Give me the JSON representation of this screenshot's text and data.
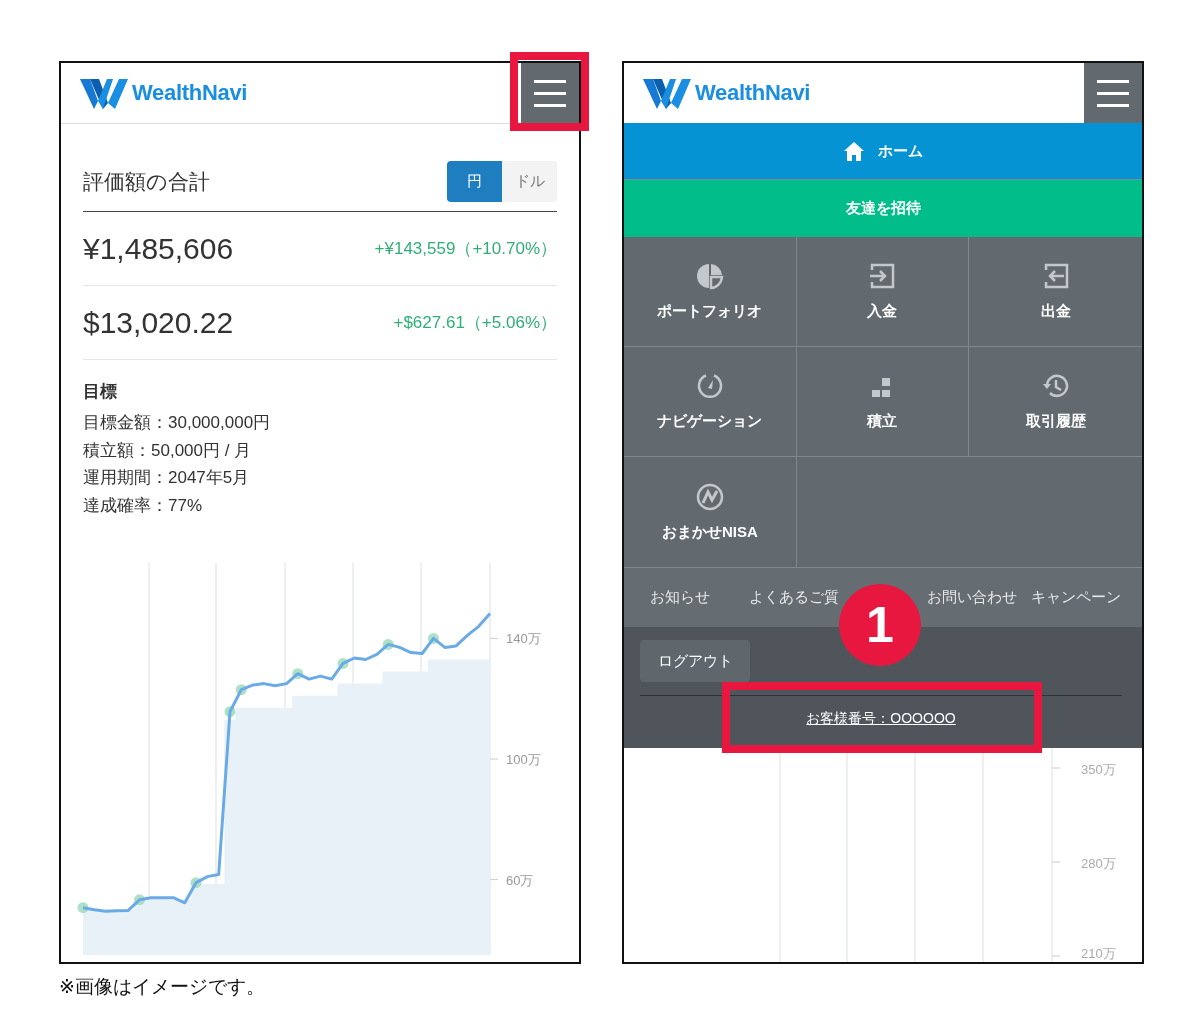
{
  "left_screen": {
    "logo": "WealthNavi",
    "title": "評価額の合計",
    "currency_toggle": [
      {
        "label": "円",
        "selected": true
      },
      {
        "label": "ドル",
        "selected": false
      }
    ],
    "totals": [
      {
        "amount": "¥1,485,606",
        "change": "+¥143,559（+10.70%）"
      },
      {
        "amount": "$13,020.22",
        "change": "+$627.61（+5.06%）"
      }
    ],
    "goal": {
      "heading": "目標",
      "lines": [
        "目標金額：30,000,000円",
        "積立額：50,000円 / 月",
        "運用期間：2047年5月",
        "達成確率：77%"
      ]
    },
    "chart_data": {
      "type": "line",
      "grid": true,
      "ylim": [
        35,
        165
      ],
      "yticks": [
        {
          "value": 60,
          "label": "60万"
        },
        {
          "value": 100,
          "label": "100万"
        },
        {
          "value": 140,
          "label": "140万"
        }
      ],
      "series": [
        {
          "type": "line",
          "color": "#6aaae6",
          "values": [
            50.7,
            50,
            49.5,
            49.7,
            49.8,
            53.3,
            54,
            54,
            54,
            52.3,
            59,
            61,
            61.7,
            115.7,
            123,
            124.5,
            125,
            124.3,
            125,
            128.3,
            126.5,
            127.5,
            126.5,
            131.7,
            133.5,
            133,
            134.7,
            138,
            137,
            135.3,
            135,
            140,
            137,
            137.5,
            141,
            144,
            148.3
          ]
        },
        {
          "type": "area",
          "color": "#e9f1f8",
          "values": [
            50,
            50,
            50,
            50,
            50,
            53.5,
            53.5,
            53.5,
            53.5,
            53.5,
            58.5,
            58.5,
            58.5,
            113,
            117,
            117,
            117,
            117,
            117,
            121,
            121,
            121,
            121,
            125,
            125,
            125,
            125,
            129,
            129,
            129,
            129,
            133,
            133,
            133,
            133,
            133,
            133
          ]
        }
      ]
    }
  },
  "right_screen": {
    "logo": "WealthNavi",
    "menu": {
      "home": "ホーム",
      "invite": "友達を招待",
      "tiles": [
        "ポートフォリオ",
        "入金",
        "出金",
        "ナビゲーション",
        "積立",
        "取引履歴",
        "おまかせNISA"
      ],
      "links": [
        "お知らせ",
        "よくあるご質",
        "お問い合わせ",
        "キャンペーン"
      ],
      "logout": "ログアウト",
      "customer_number": "お客様番号：OOOOOO"
    },
    "chart": {
      "tick_labels": [
        "350万",
        "280万",
        "210万"
      ]
    }
  },
  "caption": "※画像はイメージです。",
  "annotations": [
    {
      "kind": "highlight"
    },
    {
      "kind": "step_number",
      "label": "1"
    },
    {
      "kind": "highlight"
    }
  ]
}
